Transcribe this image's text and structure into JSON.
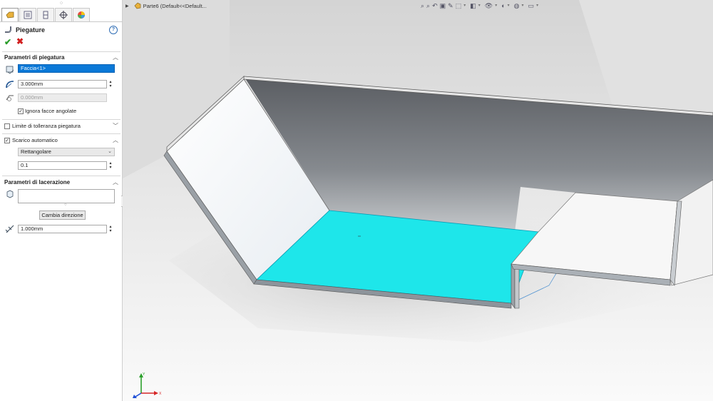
{
  "property_manager": {
    "title": "Piegature",
    "help_icon": "?",
    "ok_icon": "✔",
    "cancel_icon": "✖",
    "bend_params": {
      "heading": "Parametri di piegatura",
      "face_value": "Faccia<1>",
      "radius_value": "3.000mm",
      "k_value": "0.000mm",
      "ignore_label": "Ignora facce angolate",
      "ignore_checked": true
    },
    "tolerance": {
      "label": "Limite di tolleranza piegatura",
      "checked": false
    },
    "relief": {
      "label": "Scarico automatico",
      "checked": true,
      "type_value": "Rettangolare",
      "ratio_value": "0.1"
    },
    "tear": {
      "heading": "Parametri di lacerazione",
      "change_dir_label": "Cambia direzione",
      "gap_value": "1.000mm"
    }
  },
  "viewport": {
    "tree_label": "Parte6  (Default<<Default..."
  },
  "colors": {
    "selected_face": "#1ee6ea",
    "panel_accent": "#0a78d7",
    "background_top": "#d8d8d8"
  }
}
